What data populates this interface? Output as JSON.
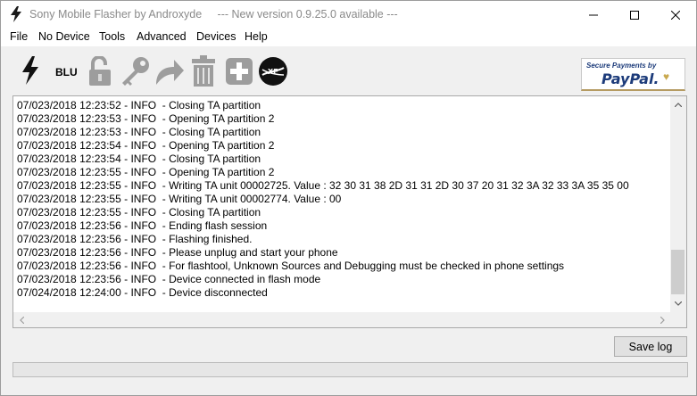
{
  "window": {
    "title": "Sony Mobile Flasher by Androxyde",
    "update_notice": "--- New version 0.9.25.0 available ---"
  },
  "menu": [
    "File",
    "No Device",
    "Tools",
    "Advanced",
    "Devices",
    "Help"
  ],
  "toolbar": {
    "icons": [
      "flash-icon",
      "blu-label",
      "unlock-icon",
      "key-icon",
      "redo-arrow-icon",
      "trash-icon",
      "plus-icon",
      "xperia-icon"
    ],
    "blu_label": "BLU"
  },
  "paypal": {
    "tagline": "Secure Payments by",
    "logo_text": "PayPal.",
    "heart": "♥"
  },
  "log": [
    "07/023/2018 12:23:52 - INFO  - Closing TA partition",
    "07/023/2018 12:23:53 - INFO  - Opening TA partition 2",
    "07/023/2018 12:23:53 - INFO  - Closing TA partition",
    "07/023/2018 12:23:54 - INFO  - Opening TA partition 2",
    "07/023/2018 12:23:54 - INFO  - Closing TA partition",
    "07/023/2018 12:23:55 - INFO  - Opening TA partition 2",
    "07/023/2018 12:23:55 - INFO  - Writing TA unit 00002725. Value : 32 30 31 38 2D 31 31 2D 30 37 20 31 32 3A 32 33 3A 35 35 00",
    "07/023/2018 12:23:55 - INFO  - Writing TA unit 00002774. Value : 00",
    "07/023/2018 12:23:55 - INFO  - Closing TA partition",
    "07/023/2018 12:23:56 - INFO  - Ending flash session",
    "07/023/2018 12:23:56 - INFO  - Flashing finished.",
    "07/023/2018 12:23:56 - INFO  - Please unplug and start your phone",
    "07/023/2018 12:23:56 - INFO  - For flashtool, Unknown Sources and Debugging must be checked in phone settings",
    "07/023/2018 12:23:56 - INFO  - Device connected in flash mode",
    "07/024/2018 12:24:00 - INFO  - Device disconnected"
  ],
  "actions": {
    "save_log": "Save log"
  },
  "progress": {
    "value": 0
  },
  "colors": {
    "progress_fill": "#06b025",
    "paypal_blue": "#1c3b7a",
    "paypal_gold": "#c9a94f"
  }
}
